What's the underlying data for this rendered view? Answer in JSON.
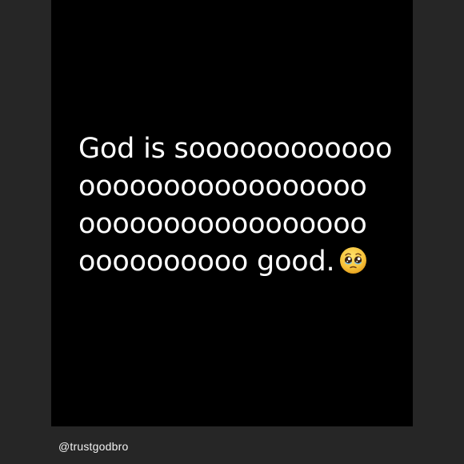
{
  "post": {
    "lines": [
      "God is soooooooooooo",
      "ooooooooooooooooo",
      "ooooooooooooooooo",
      "oooooooooo good."
    ],
    "emoji": "pleading-face-icon"
  },
  "footer": {
    "handle": "@trustgodbro"
  },
  "colors": {
    "page_background": "#262626",
    "card_background": "#000000",
    "text": "#ffffff"
  }
}
